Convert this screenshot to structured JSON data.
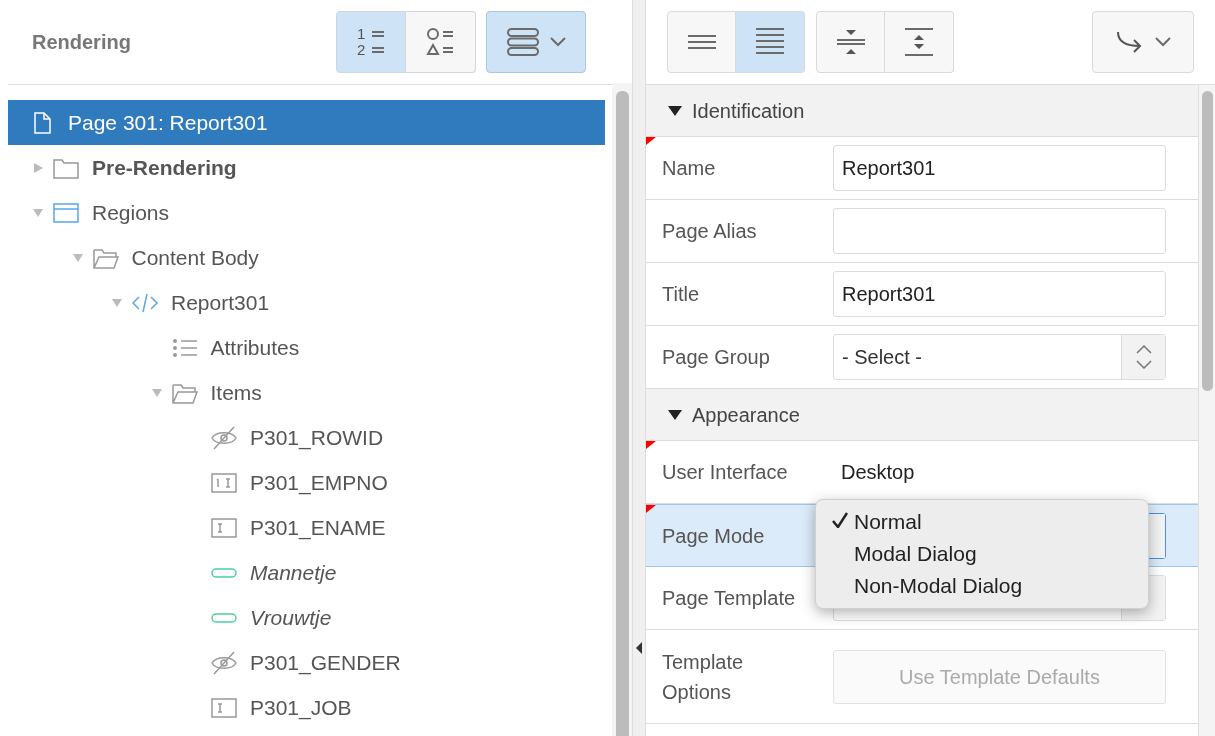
{
  "left_panel": {
    "title": "Rendering",
    "view_buttons": [
      {
        "kind": "numbered",
        "digits": [
          "1",
          "2"
        ],
        "selected": true
      },
      {
        "kind": "shapes",
        "selected": false
      }
    ],
    "layout_menu": {
      "selected": true
    }
  },
  "tree": [
    {
      "label": "Page 301: Report301",
      "kind": "page",
      "selected": true,
      "children": [
        {
          "label": "Pre-Rendering",
          "kind": "folder",
          "expanded": false,
          "selected": false
        },
        {
          "label": "Regions",
          "kind": "region",
          "expanded": true,
          "selected": false,
          "children": [
            {
              "label": "Content Body",
              "kind": "folder-open",
              "expanded": true,
              "selected": false,
              "children": [
                {
                  "label": "Report301",
                  "kind": "code",
                  "expanded": true,
                  "selected": false,
                  "children": [
                    {
                      "label": "Attributes",
                      "kind": "list",
                      "selected": false
                    },
                    {
                      "label": "Items",
                      "kind": "folder-open",
                      "expanded": true,
                      "selected": false,
                      "children": [
                        {
                          "label": "P301_ROWID",
                          "kind": "hidden",
                          "selected": false
                        },
                        {
                          "label": "P301_EMPNO",
                          "kind": "number",
                          "selected": false
                        },
                        {
                          "label": "P301_ENAME",
                          "kind": "text",
                          "selected": false
                        },
                        {
                          "label": "Mannetje",
                          "kind": "button",
                          "selected": false
                        },
                        {
                          "label": "Vrouwtje",
                          "kind": "button",
                          "selected": false
                        },
                        {
                          "label": "P301_GENDER",
                          "kind": "hidden",
                          "selected": false
                        },
                        {
                          "label": "P301_JOB",
                          "kind": "text",
                          "selected": false
                        }
                      ]
                    }
                  ]
                }
              ]
            }
          ]
        }
      ]
    }
  ],
  "right_toolbar": {
    "groups": [
      [
        {
          "kind": "few-lines",
          "selected": false
        },
        {
          "kind": "many-lines",
          "selected": true
        }
      ],
      [
        {
          "kind": "collapse",
          "selected": false
        },
        {
          "kind": "expand",
          "selected": false
        }
      ]
    ],
    "goto": {
      "selected": false
    }
  },
  "sections": [
    {
      "title": "Identification",
      "expanded": true,
      "rows": [
        {
          "label": "Name",
          "kind": "text",
          "value": "Report301",
          "required": true,
          "highlighted": false
        },
        {
          "label": "Page Alias",
          "kind": "text",
          "required": false,
          "highlighted": false
        },
        {
          "label": "Title",
          "kind": "text",
          "value": "Report301",
          "required": false,
          "highlighted": false
        },
        {
          "label": "Page Group",
          "kind": "select",
          "value": "- Select -",
          "required": false,
          "highlighted": false
        }
      ]
    },
    {
      "title": "Appearance",
      "expanded": true,
      "rows": [
        {
          "label": "User Interface",
          "kind": "static",
          "value": "Desktop",
          "required": true,
          "highlighted": false
        },
        {
          "label": "Page Mode",
          "kind": "select",
          "required": true,
          "highlighted": true,
          "menu": [
            {
              "label": "Normal",
              "selected": true
            },
            {
              "label": "Modal Dialog",
              "selected": false
            },
            {
              "label": "Non-Modal Dialog",
              "selected": false
            }
          ]
        },
        {
          "label": "Page Template",
          "kind": "select",
          "required": false,
          "highlighted": false
        },
        {
          "label": "Template Options",
          "kind": "button",
          "value": "Use Template Defaults",
          "required": false,
          "highlighted": false
        }
      ]
    }
  ]
}
